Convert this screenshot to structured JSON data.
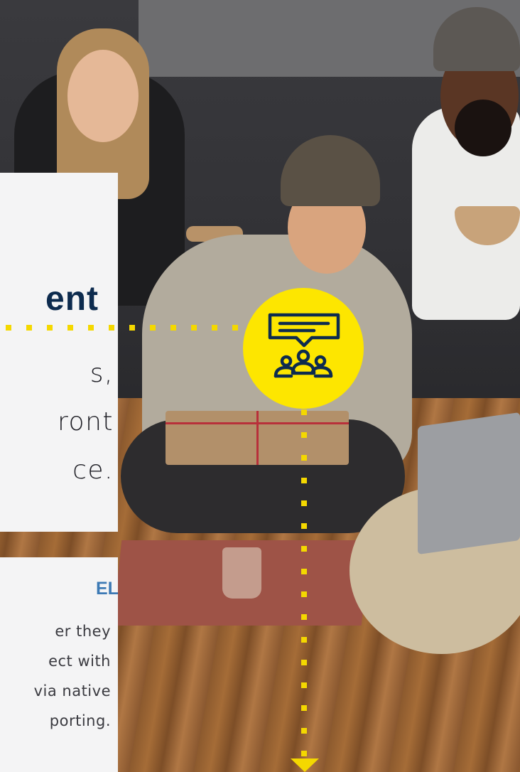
{
  "main_card": {
    "heading": "ent",
    "body_lines": [
      "s,",
      "ront",
      "ce."
    ]
  },
  "small_card": {
    "heading": "EL",
    "body_lines": [
      "er they",
      "ect with",
      "via native",
      "porting."
    ]
  },
  "badge": {
    "icon": "chat-group-icon",
    "color": "#fde600",
    "icon_color": "#0d2b4e"
  },
  "connector": {
    "color": "#f4d800",
    "arrow": "arrow-down-icon"
  },
  "colors": {
    "heading_navy": "#0d2b4e",
    "accent_blue": "#3d7ab5",
    "card_background": "#f4f4f5"
  }
}
